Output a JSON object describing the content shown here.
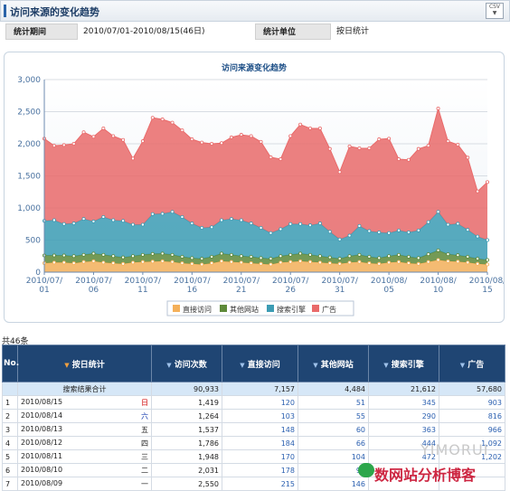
{
  "header": {
    "title": "访问来源的变化趋势",
    "csv_label": "CSV",
    "csv_icon": "download-arrow-icon"
  },
  "info": {
    "period_label": "统计期间",
    "period_value": "2010/07/01-2010/08/15(46日)",
    "unit_label": "统计单位",
    "unit_value": "按日统计"
  },
  "chart_data": {
    "type": "area",
    "title": "访问来源变化趋势",
    "stacked": true,
    "ylim": [
      0,
      3000
    ],
    "yticks": [
      0,
      500,
      1000,
      1500,
      2000,
      2500,
      3000
    ],
    "ytick_labels": [
      "0",
      "500",
      "1,000",
      "1,500",
      "2,000",
      "2,500",
      "3,000"
    ],
    "xtick_labels": [
      "2010/07/\n01",
      "2010/07/\n06",
      "2010/07/\n11",
      "2010/07/\n16",
      "2010/07/\n21",
      "2010/07/\n26",
      "2010/07/\n31",
      "2010/08/\n05",
      "2010/08/\n10",
      "2010/08/\n15"
    ],
    "xtick_index": [
      0,
      5,
      10,
      15,
      20,
      25,
      30,
      35,
      40,
      45
    ],
    "grid": true,
    "legend_position": "bottom",
    "series": [
      {
        "name": "直接访问",
        "color": "#f4b05a",
        "values": [
          140,
          150,
          150,
          140,
          160,
          170,
          150,
          140,
          130,
          150,
          160,
          165,
          170,
          160,
          140,
          130,
          120,
          140,
          170,
          160,
          150,
          140,
          130,
          120,
          150,
          160,
          170,
          160,
          150,
          140,
          130,
          150,
          160,
          140,
          130,
          150,
          160,
          140,
          130,
          160,
          190,
          170,
          165,
          150,
          130,
          120
        ]
      },
      {
        "name": "其他网站",
        "color": "#5e8a3a",
        "values": [
          120,
          110,
          110,
          110,
          110,
          120,
          120,
          110,
          100,
          100,
          110,
          120,
          120,
          110,
          100,
          90,
          90,
          100,
          120,
          110,
          100,
          100,
          90,
          90,
          100,
          110,
          120,
          110,
          100,
          90,
          80,
          100,
          110,
          100,
          90,
          100,
          110,
          100,
          90,
          120,
          150,
          110,
          100,
          90,
          80,
          70
        ]
      },
      {
        "name": "搜索引擎",
        "color": "#3c9cb4",
        "values": [
          540,
          550,
          490,
          510,
          560,
          500,
          590,
          560,
          570,
          490,
          470,
          620,
          620,
          670,
          620,
          540,
          480,
          460,
          520,
          560,
          560,
          520,
          470,
          400,
          420,
          480,
          460,
          460,
          510,
          400,
          300,
          320,
          450,
          400,
          400,
          360,
          380,
          380,
          430,
          500,
          600,
          460,
          490,
          420,
          345,
          310
        ]
      },
      {
        "name": "广告",
        "color": "#e96a6a",
        "values": [
          1280,
          1160,
          1230,
          1240,
          1350,
          1320,
          1380,
          1310,
          1260,
          1030,
          1300,
          1500,
          1470,
          1390,
          1350,
          1310,
          1330,
          1300,
          1200,
          1270,
          1330,
          1360,
          1340,
          1180,
          1090,
          1370,
          1550,
          1510,
          1480,
          1290,
          1050,
          1390,
          1210,
          1290,
          1450,
          1470,
          1110,
          1130,
          1270,
          1190,
          1610,
          1300,
          1231,
          1125,
          703,
          903
        ]
      }
    ]
  },
  "table": {
    "count_text": "共46条",
    "headers": [
      "No.",
      "按日统计",
      "访问次数",
      "直接访问",
      "其他网站",
      "搜索引擎",
      "广告"
    ],
    "summary": {
      "label": "搜索结果合计",
      "visits": "90,933",
      "direct": "7,157",
      "other": "4,484",
      "search": "21,612",
      "ads": "57,680"
    },
    "rows": [
      {
        "no": "1",
        "date": "2010/08/15",
        "day": "日",
        "visits": "1,419",
        "direct": "120",
        "other": "51",
        "search": "345",
        "ads": "903"
      },
      {
        "no": "2",
        "date": "2010/08/14",
        "day": "六",
        "visits": "1,264",
        "direct": "103",
        "other": "55",
        "search": "290",
        "ads": "816"
      },
      {
        "no": "3",
        "date": "2010/08/13",
        "day": "五",
        "visits": "1,537",
        "direct": "148",
        "other": "60",
        "search": "363",
        "ads": "966"
      },
      {
        "no": "4",
        "date": "2010/08/12",
        "day": "四",
        "visits": "1,786",
        "direct": "184",
        "other": "66",
        "search": "444",
        "ads": "1,092"
      },
      {
        "no": "5",
        "date": "2010/08/11",
        "day": "三",
        "visits": "1,948",
        "direct": "170",
        "other": "104",
        "search": "472",
        "ads": "1,202"
      },
      {
        "no": "6",
        "date": "2010/08/10",
        "day": "二",
        "visits": "2,031",
        "direct": "178",
        "other": "97",
        "search": "",
        "ads": ""
      },
      {
        "no": "7",
        "date": "2010/08/09",
        "day": "一",
        "visits": "2,550",
        "direct": "215",
        "other": "146",
        "search": "",
        "ads": ""
      }
    ]
  },
  "watermark": {
    "text1": "数",
    "text2": "网站分析博客",
    "text3": "YIMORUI"
  }
}
